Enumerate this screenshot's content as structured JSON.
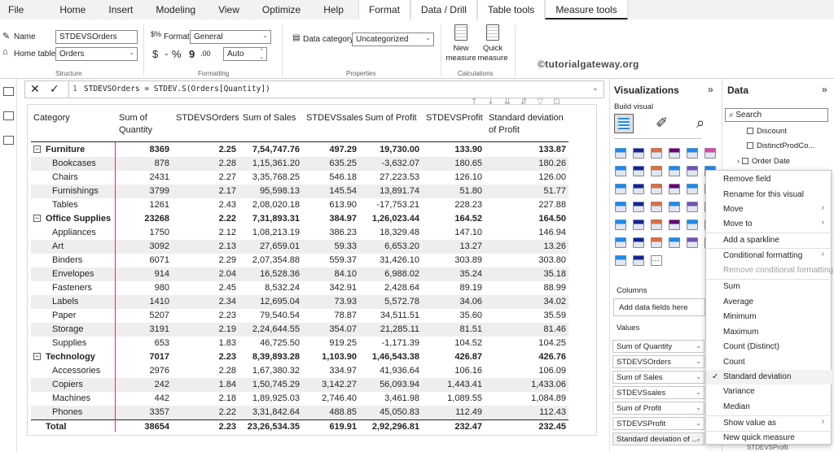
{
  "ribbon_tabs": [
    "File",
    "Home",
    "Insert",
    "Modeling",
    "View",
    "Optimize",
    "Help",
    "Format",
    "Data / Drill",
    "Table tools",
    "Measure tools"
  ],
  "structure": {
    "name_label": "Name",
    "name_value": "STDEVSOrders",
    "home_table_label": "Home table",
    "home_table_value": "Orders",
    "group": "Structure"
  },
  "formatting": {
    "format_label": "Format",
    "format_value": "General",
    "dollar": "$",
    "percent": "%",
    "comma": "9",
    "auto": "Auto",
    "group": "Formatting"
  },
  "properties": {
    "data_category_label": "Data category",
    "data_category_value": "Uncategorized",
    "group": "Properties"
  },
  "calculations": {
    "new_measure": "New measure",
    "quick_measure": "Quick measure",
    "group": "Calculations"
  },
  "logo": "©tutorialgateway.org",
  "formula": {
    "line": "1",
    "text": "STDEVSOrders = STDEV.S(Orders[Quantity])"
  },
  "table": {
    "headers": [
      "Category",
      "Sum of Quantity",
      "STDEVSOrders",
      "Sum of Sales",
      "STDEVSsales",
      "Sum of Profit",
      "STDEVSProfit",
      "Standard deviation of Profit"
    ],
    "rows": [
      {
        "type": "group",
        "cells": [
          "Furniture",
          "8369",
          "2.25",
          "7,54,747.76",
          "497.29",
          "19,730.00",
          "133.90",
          "133.87"
        ]
      },
      {
        "type": "item",
        "cells": [
          "Bookcases",
          "878",
          "2.28",
          "1,15,361.20",
          "635.25",
          "-3,632.07",
          "180.65",
          "180.26"
        ]
      },
      {
        "type": "item",
        "cells": [
          "Chairs",
          "2431",
          "2.27",
          "3,35,768.25",
          "546.18",
          "27,223.53",
          "126.10",
          "126.00"
        ]
      },
      {
        "type": "item",
        "cells": [
          "Furnishings",
          "3799",
          "2.17",
          "95,598.13",
          "145.54",
          "13,891.74",
          "51.80",
          "51.77"
        ]
      },
      {
        "type": "item",
        "cells": [
          "Tables",
          "1261",
          "2.43",
          "2,08,020.18",
          "613.90",
          "-17,753.21",
          "228.23",
          "227.88"
        ]
      },
      {
        "type": "group",
        "cells": [
          "Office Supplies",
          "23268",
          "2.22",
          "7,31,893.31",
          "384.97",
          "1,26,023.44",
          "164.52",
          "164.50"
        ]
      },
      {
        "type": "item",
        "cells": [
          "Appliances",
          "1750",
          "2.12",
          "1,08,213.19",
          "386.23",
          "18,329.48",
          "147.10",
          "146.94"
        ]
      },
      {
        "type": "item",
        "cells": [
          "Art",
          "3092",
          "2.13",
          "27,659.01",
          "59.33",
          "6,653.20",
          "13.27",
          "13.26"
        ]
      },
      {
        "type": "item",
        "cells": [
          "Binders",
          "6071",
          "2.29",
          "2,07,354.88",
          "559.37",
          "31,426.10",
          "303.89",
          "303.80"
        ]
      },
      {
        "type": "item",
        "cells": [
          "Envelopes",
          "914",
          "2.04",
          "16,528.36",
          "84.10",
          "6,988.02",
          "35.24",
          "35.18"
        ]
      },
      {
        "type": "item",
        "cells": [
          "Fasteners",
          "980",
          "2.45",
          "8,532.24",
          "342.91",
          "2,428.64",
          "89.19",
          "88.99"
        ]
      },
      {
        "type": "item",
        "cells": [
          "Labels",
          "1410",
          "2.34",
          "12,695.04",
          "73.93",
          "5,572.78",
          "34.06",
          "34.02"
        ]
      },
      {
        "type": "item",
        "cells": [
          "Paper",
          "5207",
          "2.23",
          "79,540.54",
          "78.87",
          "34,511.51",
          "35.60",
          "35.59"
        ]
      },
      {
        "type": "item",
        "cells": [
          "Storage",
          "3191",
          "2.19",
          "2,24,644.55",
          "354.07",
          "21,285.11",
          "81.51",
          "81.46"
        ]
      },
      {
        "type": "item",
        "cells": [
          "Supplies",
          "653",
          "1.83",
          "46,725.50",
          "919.25",
          "-1,171.39",
          "104.52",
          "104.25"
        ]
      },
      {
        "type": "group",
        "cells": [
          "Technology",
          "7017",
          "2.23",
          "8,39,893.28",
          "1,103.90",
          "1,46,543.38",
          "426.87",
          "426.76"
        ]
      },
      {
        "type": "item",
        "cells": [
          "Accessories",
          "2976",
          "2.28",
          "1,67,380.32",
          "334.97",
          "41,936.64",
          "106.16",
          "106.09"
        ]
      },
      {
        "type": "item",
        "cells": [
          "Copiers",
          "242",
          "1.84",
          "1,50,745.29",
          "3,142.27",
          "56,093.94",
          "1,443.41",
          "1,433.06"
        ]
      },
      {
        "type": "item",
        "cells": [
          "Machines",
          "442",
          "2.18",
          "1,89,925.03",
          "2,746.40",
          "3,461.98",
          "1,089.55",
          "1,084.89"
        ]
      },
      {
        "type": "item",
        "cells": [
          "Phones",
          "3357",
          "2.22",
          "3,31,842.64",
          "488.85",
          "45,050.83",
          "112.49",
          "112.43"
        ]
      },
      {
        "type": "total",
        "cells": [
          "Total",
          "38654",
          "2.23",
          "23,26,534.35",
          "619.91",
          "2,92,296.81",
          "232.47",
          "232.45"
        ]
      }
    ]
  },
  "visualizations": {
    "title": "Visualizations",
    "build_visual": "Build visual",
    "columns": "Columns",
    "add_fields": "Add data fields here",
    "values": "Values",
    "wells": [
      "Sum of Quantity",
      "STDEVSOrders",
      "Sum of Sales",
      "STDEVSsales",
      "Sum of Profit",
      "STDEVSProfit",
      "Standard deviation of ..."
    ]
  },
  "data_pane": {
    "title": "Data",
    "search_placeholder": "Search",
    "items": [
      "Discount",
      "DistinctProdCo...",
      "Order Date"
    ],
    "bottom_item": "STDEVSProfit"
  },
  "context_menu": {
    "items": [
      "Remove field",
      "Rename for this visual",
      "Move",
      "Move to",
      "Add a sparkline",
      "Conditional formatting",
      "Remove conditional formatting",
      "Sum",
      "Average",
      "Minimum",
      "Maximum",
      "Count (Distinct)",
      "Count",
      "Standard deviation",
      "Variance",
      "Median",
      "Show value as",
      "New quick measure"
    ],
    "checked": "Standard deviation",
    "check_mark": "✓"
  },
  "colors": {
    "accent_line": "#c43b6d",
    "alt_row": "#eeeeee"
  }
}
